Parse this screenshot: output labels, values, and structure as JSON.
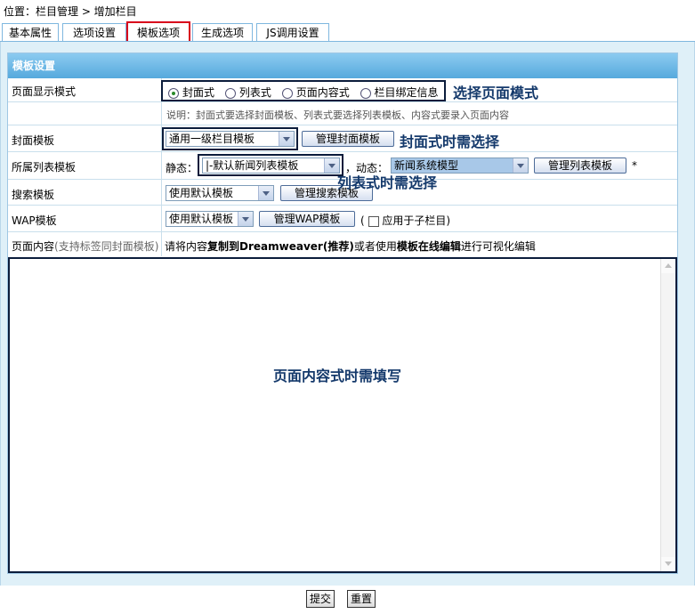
{
  "breadcrumb": {
    "text": "位置：栏目管理 > 增加栏目"
  },
  "tabs": [
    {
      "label": "基本属性"
    },
    {
      "label": "选项设置"
    },
    {
      "label": "模板选项"
    },
    {
      "label": "生成选项"
    },
    {
      "label": "JS调用设置"
    }
  ],
  "active_tab": "模板选项",
  "section": {
    "title": "模板设置"
  },
  "page_mode": {
    "label": "页面显示模式",
    "options": [
      "封面式",
      "列表式",
      "页面内容式",
      "栏目绑定信息"
    ],
    "selected": "封面式",
    "note": "说明：封面式要选择封面模板、列表式要选择列表模板、内容式要录入页面内容"
  },
  "cover_template": {
    "label": "封面模板",
    "value": "通用一级栏目模板",
    "manage_button": "管理封面模板"
  },
  "list_template": {
    "label": "所属列表模板",
    "static_label": "静态：",
    "static_value": "|-默认新闻列表模板",
    "dynamic_label": "，动态：",
    "dynamic_value": "新闻系统模型",
    "manage_button": "管理列表模板",
    "required_mark": "*"
  },
  "search_template": {
    "label": "搜索模板",
    "value": "使用默认模板",
    "manage_button": "管理搜索模板"
  },
  "wap_template": {
    "label": "WAP模板",
    "value": "使用默认模板",
    "manage_button": "管理WAP模板",
    "paren_open": "(",
    "apply_sub_label": "应用于子栏目)"
  },
  "page_content": {
    "label": "页面内容",
    "label_hint": "(支持标签同封面模板)",
    "hint_prefix": "请将内容",
    "hint_bold1": "复制到Dreamweaver(推荐)",
    "hint_mid": "或者使用",
    "hint_bold2": "模板在线编辑",
    "hint_suffix": "进行可视化编辑"
  },
  "annotations": {
    "select_mode": "选择页面模式",
    "cover_needed": "封面式时需选择",
    "list_needed": "列表式时需选择",
    "content_needed": "页面内容式时需填写"
  },
  "footer": {
    "submit": "提交",
    "reset": "重置"
  }
}
